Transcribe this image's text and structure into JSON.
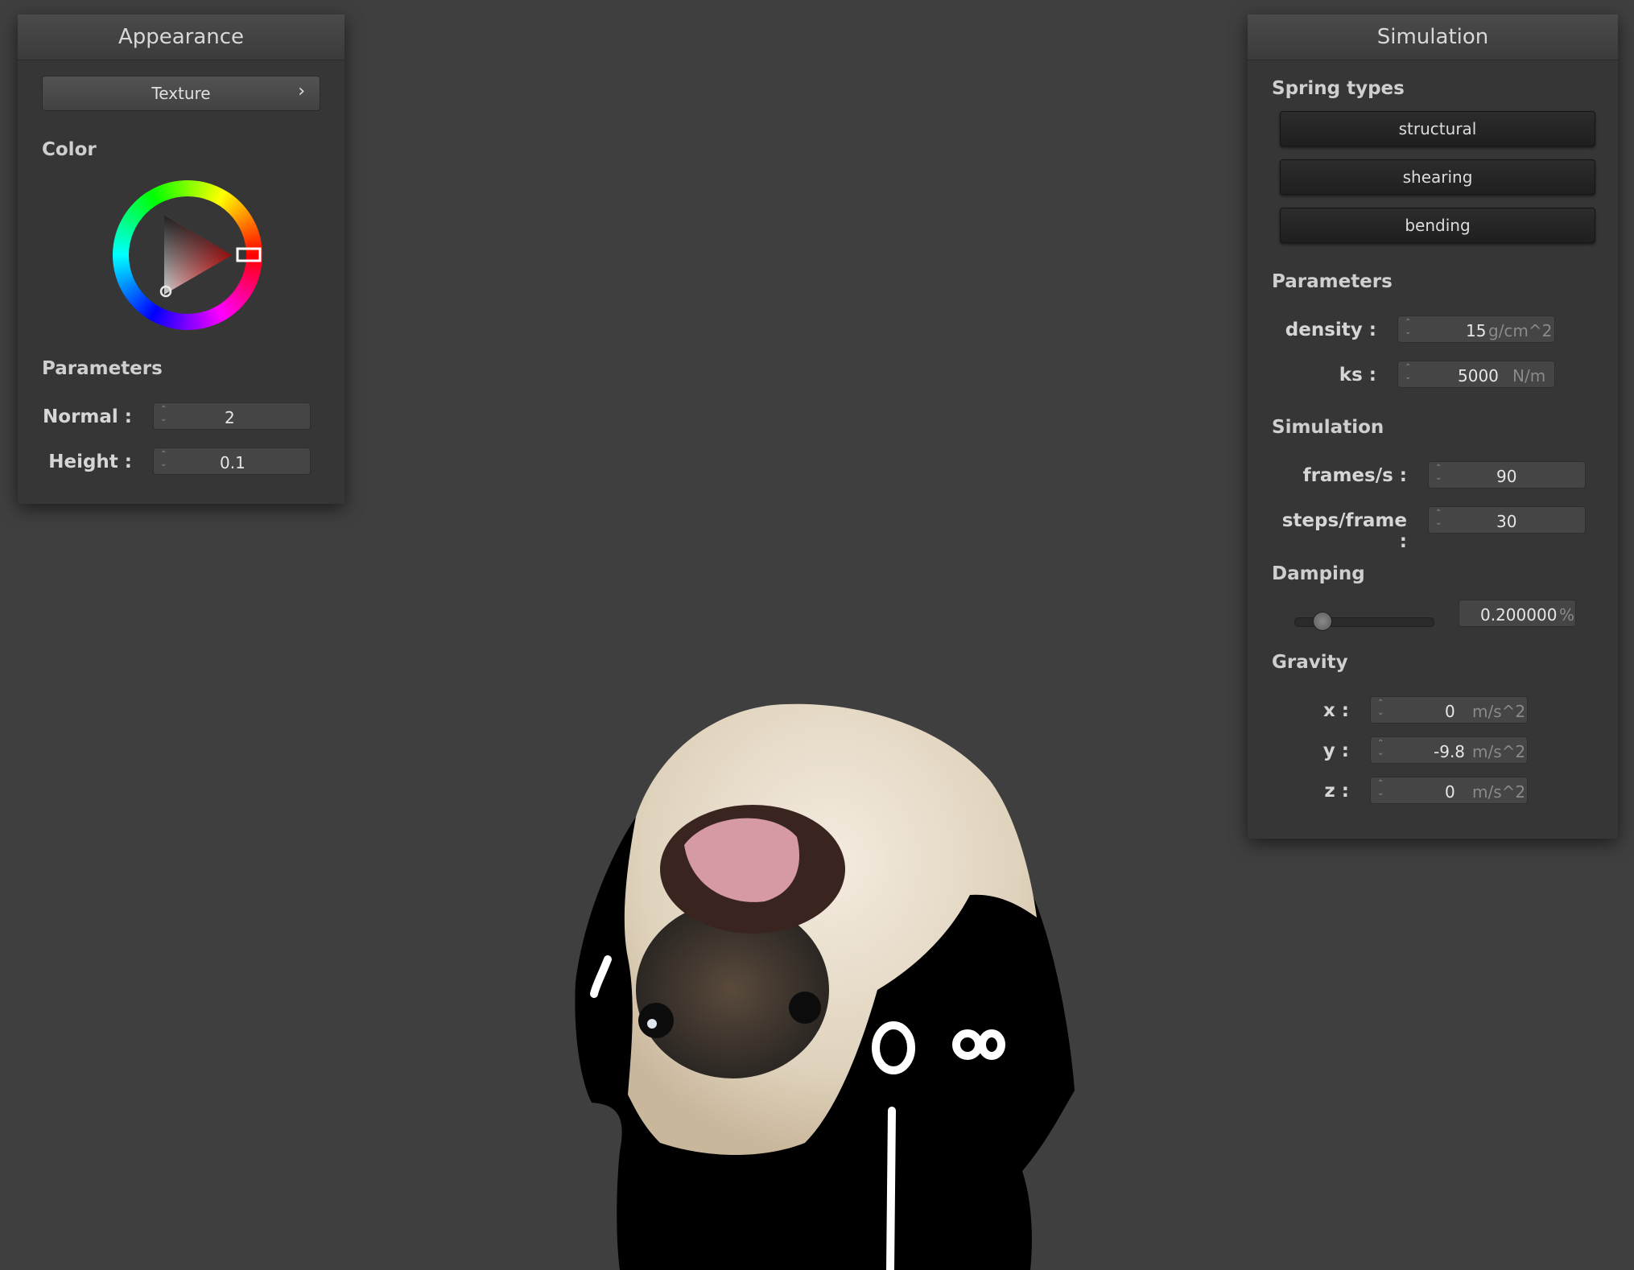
{
  "appearance": {
    "title": "Appearance",
    "texture_button": "Texture",
    "texture_chevron": "›",
    "color_title": "Color",
    "color_value": "#ff0000",
    "params_title": "Parameters",
    "normal_label": "Normal :",
    "normal_value": "2",
    "height_label": "Height :",
    "height_value": "0.1"
  },
  "simulation": {
    "title": "Simulation",
    "spring_types_title": "Spring types",
    "spring_buttons": [
      "structural",
      "shearing",
      "bending"
    ],
    "params_title": "Parameters",
    "density_label": "density :",
    "density_value": "15",
    "density_unit": "g/cm^2",
    "ks_label": "ks :",
    "ks_value": "5000",
    "ks_unit": "N/m",
    "sim_title": "Simulation",
    "fps_label": "frames/s :",
    "fps_value": "90",
    "steps_label": "steps/frame :",
    "steps_value": "30",
    "damping_title": "Damping",
    "damping_value": "0.200000",
    "damping_unit": "%",
    "damping_fraction": 0.2,
    "gravity_title": "Gravity",
    "gx_label": "x :",
    "gx_value": "0",
    "gy_label": "y :",
    "gy_value": "-9.8",
    "gz_label": "z :",
    "gz_value": "0",
    "g_unit": "m/s^2"
  },
  "colors": {
    "background": "#3f3f3f",
    "panel": "#363636",
    "cloth_black": "#000000",
    "fur": "#e4d9c6"
  }
}
